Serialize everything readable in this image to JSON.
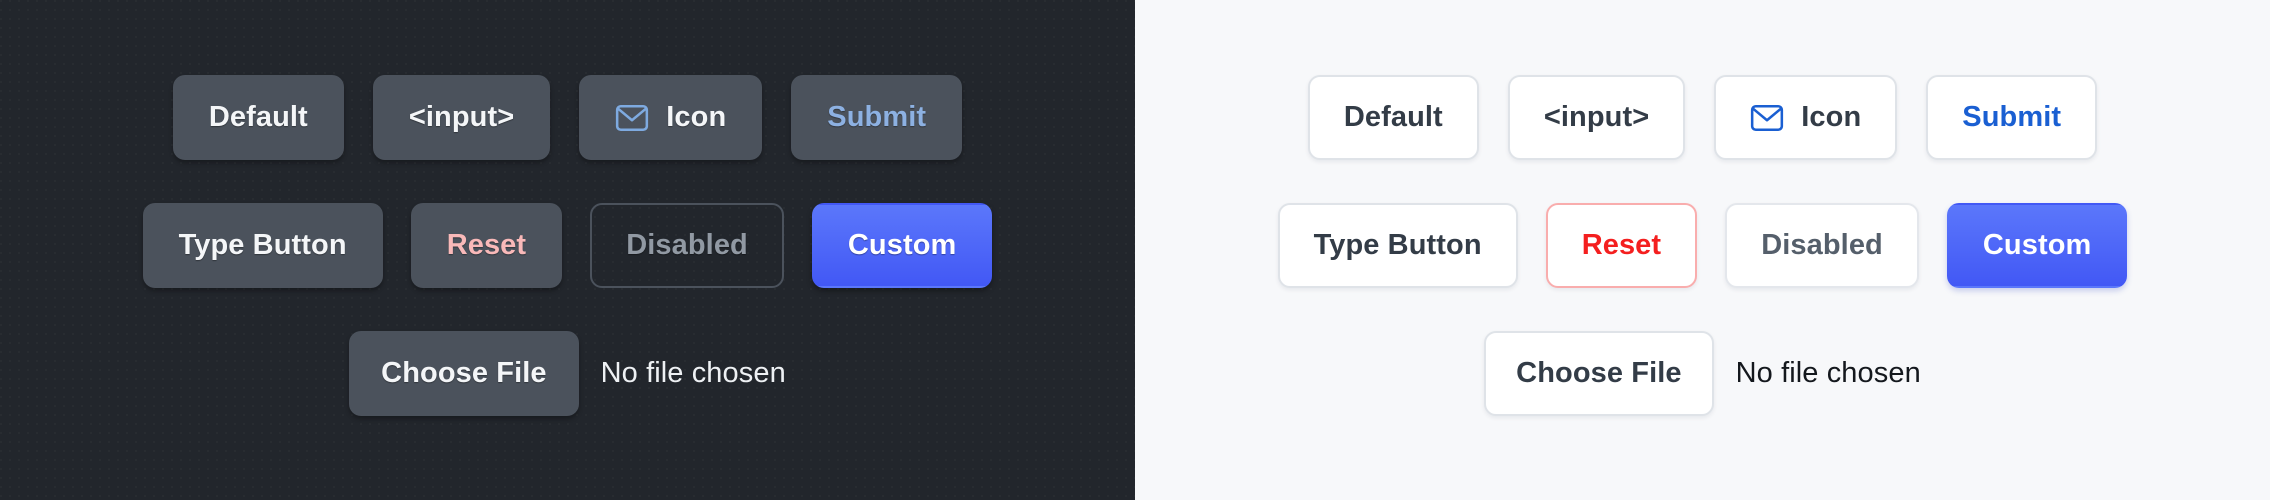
{
  "panels": [
    {
      "theme": "dark",
      "background": "#22262c",
      "rows": [
        {
          "buttons": [
            {
              "label": "Default",
              "variant": "default",
              "icon": null
            },
            {
              "label": "<input>",
              "variant": "default",
              "icon": null
            },
            {
              "label": "Icon",
              "variant": "default",
              "icon": "envelope-icon"
            },
            {
              "label": "Submit",
              "variant": "submit",
              "icon": null
            }
          ]
        },
        {
          "buttons": [
            {
              "label": "Type Button",
              "variant": "default",
              "icon": null
            },
            {
              "label": "Reset",
              "variant": "reset",
              "icon": null
            },
            {
              "label": "Disabled",
              "variant": "disabled",
              "icon": null
            },
            {
              "label": "Custom",
              "variant": "custom",
              "icon": null
            }
          ]
        }
      ],
      "file_input": {
        "button_label": "Choose File",
        "status_text": "No file chosen"
      },
      "colors": {
        "button_bg": "#4b525c",
        "button_text": "#f4f6f8",
        "submit_text": "#8db1e2",
        "reset_text": "#f9b9b9",
        "disabled_text": "#9199a3",
        "disabled_border": "#4b525c",
        "custom_bg_top": "#5b77fb",
        "custom_bg_bottom": "#4258f5",
        "icon_stroke": "#7eaae0",
        "file_name_text": "#eef1f4"
      }
    },
    {
      "theme": "light",
      "background": "#f7f8fa",
      "rows": [
        {
          "buttons": [
            {
              "label": "Default",
              "variant": "default",
              "icon": null
            },
            {
              "label": "<input>",
              "variant": "default",
              "icon": null
            },
            {
              "label": "Icon",
              "variant": "default",
              "icon": "envelope-icon"
            },
            {
              "label": "Submit",
              "variant": "submit",
              "icon": null
            }
          ]
        },
        {
          "buttons": [
            {
              "label": "Type Button",
              "variant": "default",
              "icon": null
            },
            {
              "label": "Reset",
              "variant": "reset",
              "icon": null
            },
            {
              "label": "Disabled",
              "variant": "disabled",
              "icon": null
            },
            {
              "label": "Custom",
              "variant": "custom",
              "icon": null
            }
          ]
        }
      ],
      "file_input": {
        "button_label": "Choose File",
        "status_text": "No file chosen"
      },
      "colors": {
        "button_bg": "#ffffff",
        "button_text": "#333c47",
        "button_border": "#dfe3e8",
        "submit_text": "#1a5fd2",
        "reset_text": "#f41f1f",
        "reset_border": "#f9adad",
        "disabled_text": "#555f6b",
        "disabled_border": "#e4e7ec",
        "custom_bg_top": "#5b77fb",
        "custom_bg_bottom": "#4258f5",
        "icon_stroke": "#1a5fd2",
        "file_name_text": "#14181d"
      }
    }
  ]
}
